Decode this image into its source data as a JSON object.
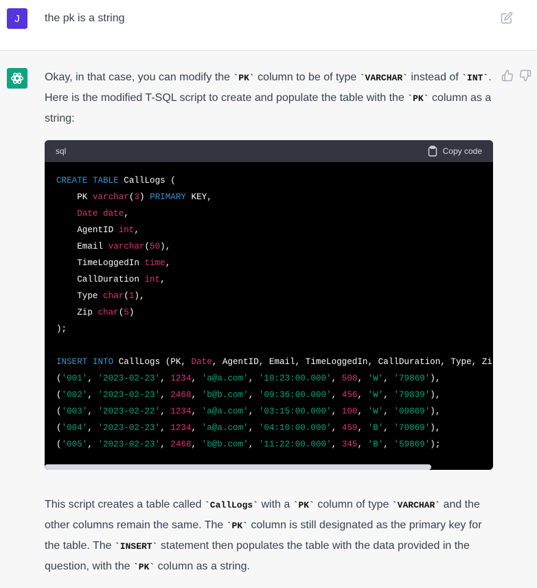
{
  "user_message": {
    "avatar_letter": "J",
    "text": "the pk is a string"
  },
  "intro_paragraph": [
    {
      "t": "Okay, in that case, you can modify the "
    },
    {
      "t": "`PK`",
      "code": true
    },
    {
      "t": " column to be of type "
    },
    {
      "t": "`VARCHAR`",
      "code": true
    },
    {
      "t": " instead of "
    },
    {
      "t": "`INT`",
      "code": true
    },
    {
      "t": ". Here is the modified T-SQL script to create and populate the table with the "
    },
    {
      "t": "`PK`",
      "code": true
    },
    {
      "t": " column as a string:"
    }
  ],
  "code_block": {
    "language": "sql",
    "copy_label": "Copy code",
    "lines": [
      [
        [
          "kw",
          "CREATE TABLE"
        ],
        [
          "pl",
          " CallLogs ("
        ]
      ],
      [
        [
          "pl",
          "    PK "
        ],
        [
          "ty",
          "varchar"
        ],
        [
          "pl",
          "("
        ],
        [
          "num",
          "3"
        ],
        [
          "pl",
          ") "
        ],
        [
          "kw",
          "PRIMARY"
        ],
        [
          "pl",
          " KEY,"
        ]
      ],
      [
        [
          "pl",
          "    "
        ],
        [
          "ty",
          "Date date"
        ],
        [
          "pl",
          ","
        ]
      ],
      [
        [
          "pl",
          "    AgentID "
        ],
        [
          "ty",
          "int"
        ],
        [
          "pl",
          ","
        ]
      ],
      [
        [
          "pl",
          "    Email "
        ],
        [
          "ty",
          "varchar"
        ],
        [
          "pl",
          "("
        ],
        [
          "num",
          "50"
        ],
        [
          "pl",
          "),"
        ]
      ],
      [
        [
          "pl",
          "    TimeLoggedIn "
        ],
        [
          "ty",
          "time"
        ],
        [
          "pl",
          ","
        ]
      ],
      [
        [
          "pl",
          "    CallDuration "
        ],
        [
          "ty",
          "int"
        ],
        [
          "pl",
          ","
        ]
      ],
      [
        [
          "pl",
          "    Type "
        ],
        [
          "ty",
          "char"
        ],
        [
          "pl",
          "("
        ],
        [
          "num",
          "1"
        ],
        [
          "pl",
          "),"
        ]
      ],
      [
        [
          "pl",
          "    Zip "
        ],
        [
          "ty",
          "char"
        ],
        [
          "pl",
          "("
        ],
        [
          "num",
          "5"
        ],
        [
          "pl",
          ")"
        ]
      ],
      [
        [
          "pl",
          ");"
        ]
      ],
      [
        [
          "pl",
          ""
        ]
      ],
      [
        [
          "kw",
          "INSERT INTO"
        ],
        [
          "pl",
          " CallLogs (PK, "
        ],
        [
          "ty",
          "Date"
        ],
        [
          "pl",
          ", AgentID, Email, TimeLoggedIn, CallDuration, Type, Zip)"
        ]
      ],
      [
        [
          "pl",
          "("
        ],
        [
          "str",
          "'001'"
        ],
        [
          "pl",
          ", "
        ],
        [
          "str",
          "'2023-02-23'"
        ],
        [
          "pl",
          ", "
        ],
        [
          "num",
          "1234"
        ],
        [
          "pl",
          ", "
        ],
        [
          "str",
          "'a@a.com'"
        ],
        [
          "pl",
          ", "
        ],
        [
          "str",
          "'10:23:00.000'"
        ],
        [
          "pl",
          ", "
        ],
        [
          "num",
          "500"
        ],
        [
          "pl",
          ", "
        ],
        [
          "str",
          "'W'"
        ],
        [
          "pl",
          ", "
        ],
        [
          "str",
          "'79869'"
        ],
        [
          "pl",
          "),"
        ]
      ],
      [
        [
          "pl",
          "("
        ],
        [
          "str",
          "'002'"
        ],
        [
          "pl",
          ", "
        ],
        [
          "str",
          "'2023-02-23'"
        ],
        [
          "pl",
          ", "
        ],
        [
          "num",
          "2468"
        ],
        [
          "pl",
          ", "
        ],
        [
          "str",
          "'b@b.com'"
        ],
        [
          "pl",
          ", "
        ],
        [
          "str",
          "'09:36:00.000'"
        ],
        [
          "pl",
          ", "
        ],
        [
          "num",
          "456"
        ],
        [
          "pl",
          ", "
        ],
        [
          "str",
          "'W'"
        ],
        [
          "pl",
          ", "
        ],
        [
          "str",
          "'79839'"
        ],
        [
          "pl",
          "),"
        ]
      ],
      [
        [
          "pl",
          "("
        ],
        [
          "str",
          "'003'"
        ],
        [
          "pl",
          ", "
        ],
        [
          "str",
          "'2023-02-22'"
        ],
        [
          "pl",
          ", "
        ],
        [
          "num",
          "1234"
        ],
        [
          "pl",
          ", "
        ],
        [
          "str",
          "'a@a.com'"
        ],
        [
          "pl",
          ", "
        ],
        [
          "str",
          "'03:15:00.000'"
        ],
        [
          "pl",
          ", "
        ],
        [
          "num",
          "100"
        ],
        [
          "pl",
          ", "
        ],
        [
          "str",
          "'W'"
        ],
        [
          "pl",
          ", "
        ],
        [
          "str",
          "'09869'"
        ],
        [
          "pl",
          "),"
        ]
      ],
      [
        [
          "pl",
          "("
        ],
        [
          "str",
          "'004'"
        ],
        [
          "pl",
          ", "
        ],
        [
          "str",
          "'2023-02-23'"
        ],
        [
          "pl",
          ", "
        ],
        [
          "num",
          "1234"
        ],
        [
          "pl",
          ", "
        ],
        [
          "str",
          "'a@a.com'"
        ],
        [
          "pl",
          ", "
        ],
        [
          "str",
          "'04:10:00.000'"
        ],
        [
          "pl",
          ", "
        ],
        [
          "num",
          "459"
        ],
        [
          "pl",
          ", "
        ],
        [
          "str",
          "'B'"
        ],
        [
          "pl",
          ", "
        ],
        [
          "str",
          "'70869'"
        ],
        [
          "pl",
          "),"
        ]
      ],
      [
        [
          "pl",
          "("
        ],
        [
          "str",
          "'005'"
        ],
        [
          "pl",
          ", "
        ],
        [
          "str",
          "'2023-02-23'"
        ],
        [
          "pl",
          ", "
        ],
        [
          "num",
          "2468"
        ],
        [
          "pl",
          ", "
        ],
        [
          "str",
          "'b@b.com'"
        ],
        [
          "pl",
          ", "
        ],
        [
          "str",
          "'11:22:00.000'"
        ],
        [
          "pl",
          ", "
        ],
        [
          "num",
          "345"
        ],
        [
          "pl",
          ", "
        ],
        [
          "str",
          "'B'"
        ],
        [
          "pl",
          ", "
        ],
        [
          "str",
          "'59869'"
        ],
        [
          "pl",
          ");"
        ]
      ]
    ]
  },
  "outro_paragraph": [
    {
      "t": "This script creates a table called "
    },
    {
      "t": "`CallLogs`",
      "code": true
    },
    {
      "t": " with a "
    },
    {
      "t": "`PK`",
      "code": true
    },
    {
      "t": " column of type "
    },
    {
      "t": "`VARCHAR`",
      "code": true
    },
    {
      "t": " and the other columns remain the same. The "
    },
    {
      "t": "`PK`",
      "code": true
    },
    {
      "t": " column is still designated as the primary key for the table. The "
    },
    {
      "t": "`INSERT`",
      "code": true
    },
    {
      "t": " statement then populates the table with the data provided in the question, with the "
    },
    {
      "t": "`PK`",
      "code": true
    },
    {
      "t": " column as a string."
    }
  ]
}
